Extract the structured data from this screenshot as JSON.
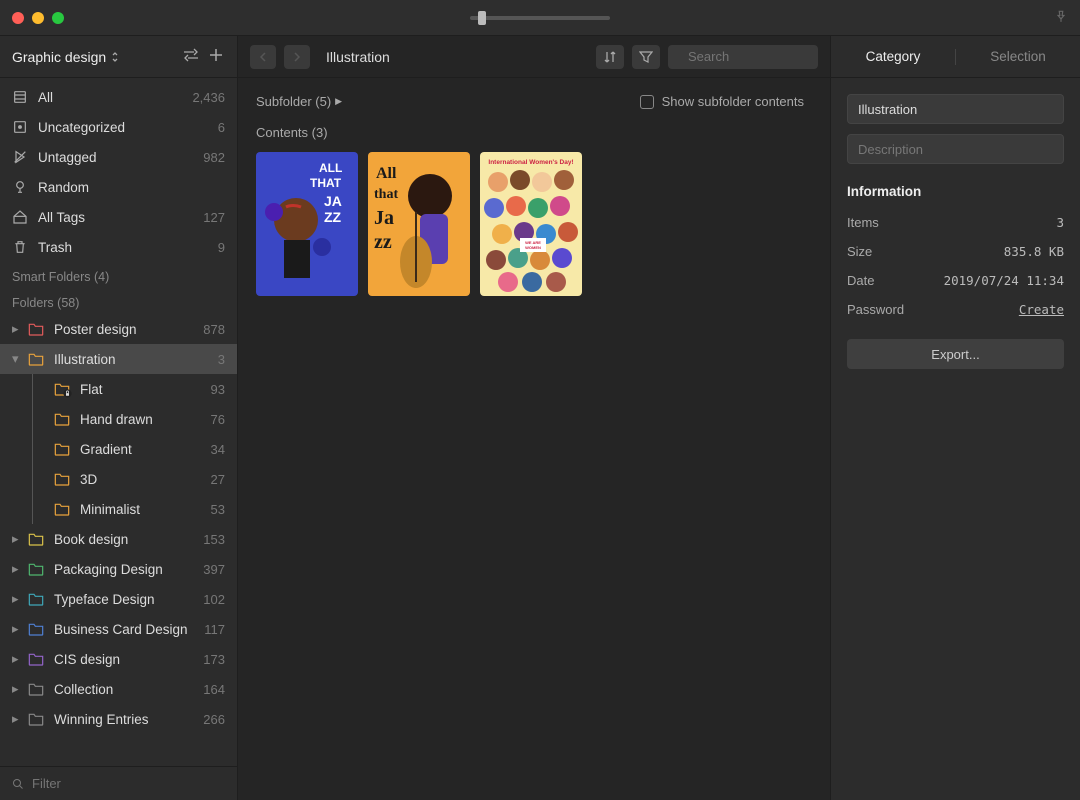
{
  "library": {
    "name": "Graphic design"
  },
  "sidebar": {
    "filter_placeholder": "Filter",
    "smart_items": [
      {
        "icon": "all",
        "label": "All",
        "count": "2,436"
      },
      {
        "icon": "uncategorized",
        "label": "Uncategorized",
        "count": "6"
      },
      {
        "icon": "untagged",
        "label": "Untagged",
        "count": "982"
      },
      {
        "icon": "random",
        "label": "Random",
        "count": ""
      },
      {
        "icon": "alltags",
        "label": "All Tags",
        "count": "127"
      },
      {
        "icon": "trash",
        "label": "Trash",
        "count": "9"
      }
    ],
    "smart_folders_label": "Smart Folders (4)",
    "folders_label": "Folders (58)",
    "folders": [
      {
        "label": "Poster design",
        "count": "878",
        "color": "#e25b5b",
        "expandable": true
      },
      {
        "label": "Illustration",
        "count": "3",
        "color": "#e8a23c",
        "expandable": true,
        "selected": true,
        "expanded": true,
        "children": [
          {
            "label": "Flat",
            "count": "93",
            "locked": true
          },
          {
            "label": "Hand drawn",
            "count": "76"
          },
          {
            "label": "Gradient",
            "count": "34"
          },
          {
            "label": "3D",
            "count": "27"
          },
          {
            "label": "Minimalist",
            "count": "53"
          }
        ]
      },
      {
        "label": "Book design",
        "count": "153",
        "color": "#d9c14a",
        "expandable": true
      },
      {
        "label": "Packaging Design",
        "count": "397",
        "color": "#4fb56e",
        "expandable": true
      },
      {
        "label": "Typeface Design",
        "count": "102",
        "color": "#3fa7b8",
        "expandable": true
      },
      {
        "label": "Business Card Design",
        "count": "117",
        "color": "#4f7fd1",
        "expandable": true
      },
      {
        "label": "CIS design",
        "count": "173",
        "color": "#9264c8",
        "expandable": true
      },
      {
        "label": "Collection",
        "count": "164",
        "color": "#888",
        "expandable": true
      },
      {
        "label": "Winning Entries",
        "count": "266",
        "color": "#888",
        "expandable": true
      }
    ]
  },
  "content": {
    "breadcrumb": "Illustration",
    "subfolder_label": "Subfolder (5)",
    "show_subfolder_label": "Show subfolder contents",
    "contents_label": "Contents (3)",
    "search_placeholder": "Search",
    "thumbs": [
      {
        "title": "All That Jazz (blue)"
      },
      {
        "title": "All That Jazz (orange)"
      },
      {
        "title": "International Women's Day!"
      }
    ]
  },
  "inspector": {
    "tabs": {
      "category": "Category",
      "selection": "Selection"
    },
    "name_value": "Illustration",
    "description_placeholder": "Description",
    "info_title": "Information",
    "rows": {
      "items_label": "Items",
      "items_value": "3",
      "size_label": "Size",
      "size_value": "835.8 KB",
      "date_label": "Date",
      "date_value": "2019/07/24 11:34",
      "password_label": "Password",
      "password_value": "Create"
    },
    "export_label": "Export..."
  }
}
